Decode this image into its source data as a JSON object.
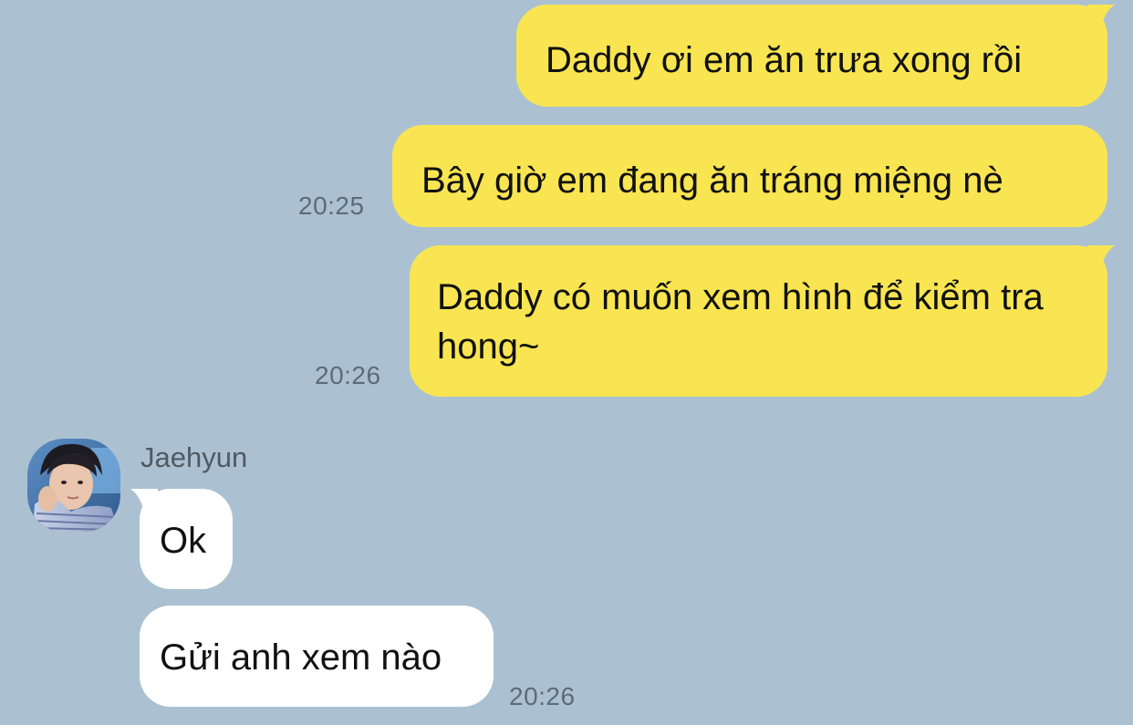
{
  "conversation": {
    "outgoing": [
      {
        "text": "Daddy ơi em ăn trưa xong rồi",
        "time": ""
      },
      {
        "text": "Bây giờ em đang ăn tráng miệng nè",
        "time": "20:25"
      },
      {
        "text": "Daddy có muốn xem hình để kiểm tra hong~",
        "time": "20:26"
      }
    ],
    "incoming": {
      "sender": "Jaehyun",
      "avatar_icon": "profile-photo",
      "messages": [
        {
          "text": "Ok"
        },
        {
          "text": "Gửi anh xem nào",
          "time": "20:26"
        }
      ]
    }
  },
  "colors": {
    "background": "#abc1d1",
    "outgoing_bubble": "#f8e551",
    "incoming_bubble": "#ffffff",
    "timestamp": "#5e6b77"
  }
}
